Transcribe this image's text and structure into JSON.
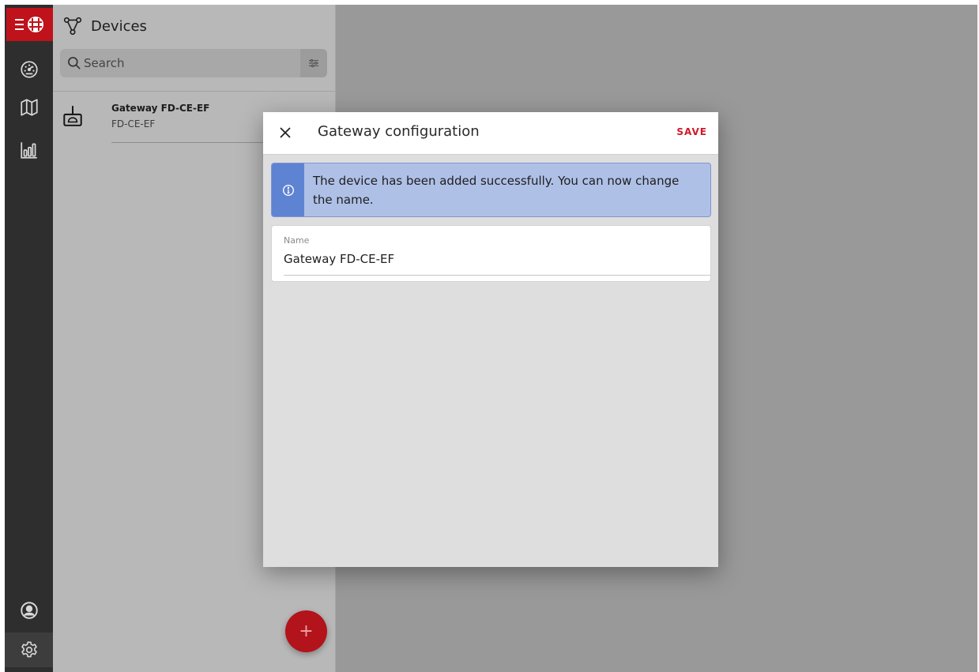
{
  "rail": {
    "logo_icon": "menu-logo-icon",
    "items": [
      "dashboard-icon",
      "map-icon",
      "charts-icon"
    ],
    "bottom_items": [
      "account-icon",
      "settings-icon"
    ],
    "accent": "#c0121b"
  },
  "panel": {
    "title": "Devices",
    "search_placeholder": "Search",
    "devices": [
      {
        "name": "Gateway FD-CE-EF",
        "id": "FD-CE-EF"
      }
    ],
    "add_label": "+"
  },
  "modal": {
    "close_label": "✕",
    "title": "Gateway configuration",
    "save_label": "SAVE",
    "info_text": "The device has been added successfully. You can now change the name.",
    "name_label": "Name",
    "name_value": "Gateway FD-CE-EF",
    "info_color": "#5f83d3",
    "save_color": "#d0182a"
  }
}
